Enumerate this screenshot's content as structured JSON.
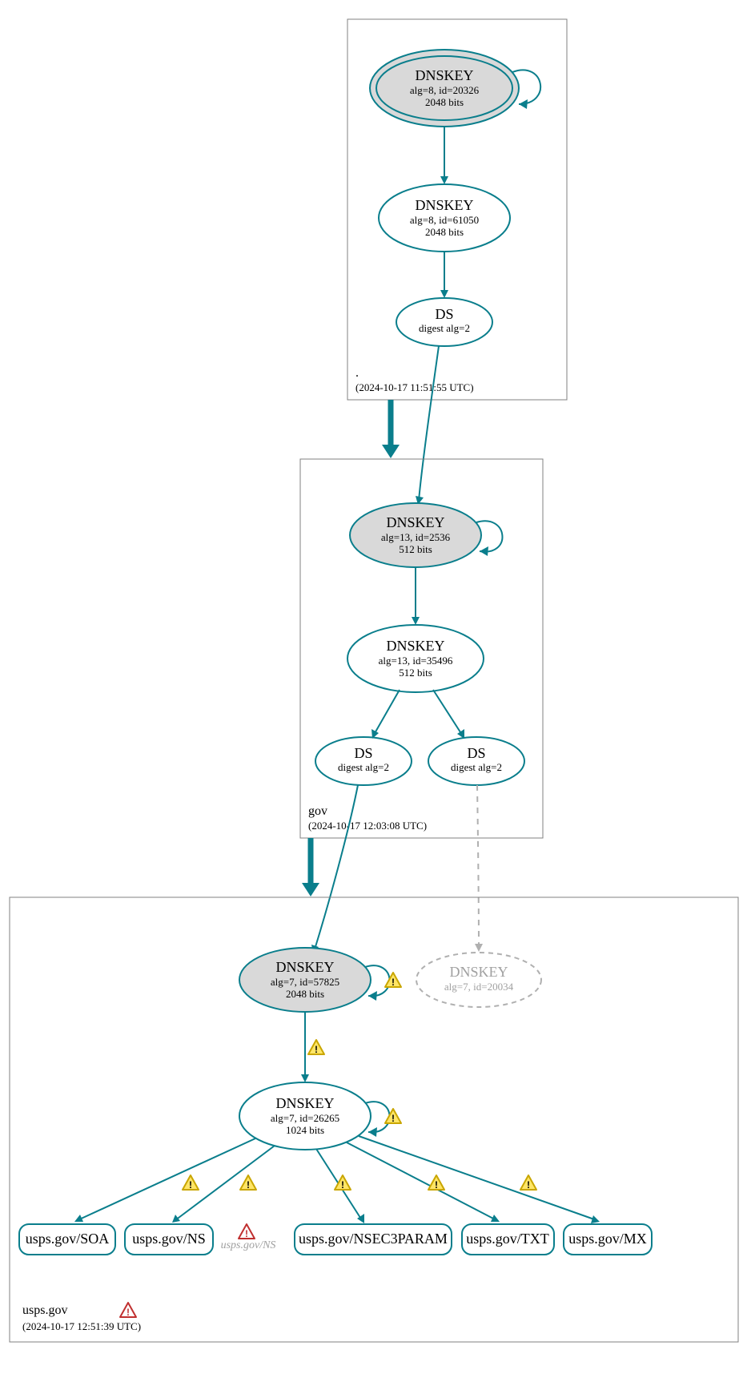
{
  "zones": {
    "root": {
      "name": ".",
      "timestamp": "(2024-10-17 11:51:55 UTC)"
    },
    "gov": {
      "name": "gov",
      "timestamp": "(2024-10-17 12:03:08 UTC)"
    },
    "usps": {
      "name": "usps.gov",
      "timestamp": "(2024-10-17 12:51:39 UTC)"
    }
  },
  "nodes": {
    "root_ksk": {
      "title": "DNSKEY",
      "line2": "alg=8, id=20326",
      "line3": "2048 bits"
    },
    "root_zsk": {
      "title": "DNSKEY",
      "line2": "alg=8, id=61050",
      "line3": "2048 bits"
    },
    "root_ds": {
      "title": "DS",
      "line2": "digest alg=2"
    },
    "gov_ksk": {
      "title": "DNSKEY",
      "line2": "alg=13, id=2536",
      "line3": "512 bits"
    },
    "gov_zsk": {
      "title": "DNSKEY",
      "line2": "alg=13, id=35496",
      "line3": "512 bits"
    },
    "gov_ds1": {
      "title": "DS",
      "line2": "digest alg=2"
    },
    "gov_ds2": {
      "title": "DS",
      "line2": "digest alg=2"
    },
    "usps_ksk": {
      "title": "DNSKEY",
      "line2": "alg=7, id=57825",
      "line3": "2048 bits"
    },
    "usps_zsk": {
      "title": "DNSKEY",
      "line2": "alg=7, id=26265",
      "line3": "1024 bits"
    },
    "usps_missing": {
      "title": "DNSKEY",
      "line2": "alg=7, id=20034"
    },
    "rr_soa": "usps.gov/SOA",
    "rr_ns": "usps.gov/NS",
    "rr_ns_err": "usps.gov/NS",
    "rr_nsec3": "usps.gov/NSEC3PARAM",
    "rr_txt": "usps.gov/TXT",
    "rr_mx": "usps.gov/MX"
  }
}
